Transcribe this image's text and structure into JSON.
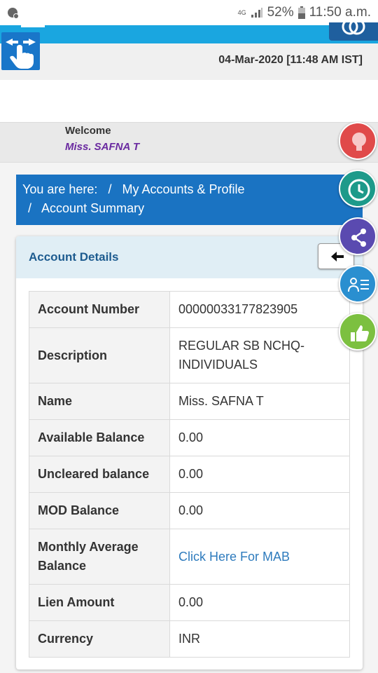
{
  "status_bar": {
    "network": "4G",
    "battery": "52%",
    "time": "11:50 a.m."
  },
  "header": {
    "datetime": "04-Mar-2020 [11:48 AM IST]"
  },
  "welcome": {
    "label": "Welcome",
    "name": "Miss. SAFNA T"
  },
  "breadcrumb": {
    "prefix": "You are here:",
    "separator": "/",
    "items": [
      "My Accounts & Profile",
      "Account Summary"
    ]
  },
  "panel": {
    "title": "Account Details"
  },
  "account_details": [
    {
      "label": "Account Number",
      "value": "00000033177823905"
    },
    {
      "label": "Description",
      "value": "REGULAR SB NCHQ-INDIVIDUALS"
    },
    {
      "label": "Name",
      "value": "Miss. SAFNA T"
    },
    {
      "label": "Available Balance",
      "value": "0.00"
    },
    {
      "label": "Uncleared balance",
      "value": "0.00"
    },
    {
      "label": "MOD Balance",
      "value": "0.00"
    },
    {
      "label": "Monthly Average Balance",
      "value": "Click Here For MAB"
    },
    {
      "label": "Lien Amount",
      "value": "0.00"
    },
    {
      "label": "Currency",
      "value": "INR"
    }
  ],
  "icons": {
    "status_left": "notification-icon",
    "signal": "signal-icon",
    "battery": "battery-icon",
    "logo": "swipe-hand-icon",
    "back": "arrow-left-icon",
    "fab_1": "lightbulb-icon",
    "fab_2": "history-icon",
    "fab_3": "share-icon",
    "fab_4": "list-user-icon",
    "fab_5": "thumbs-up-icon"
  },
  "colors": {
    "header_blue": "#1aa6e0",
    "breadcrumb_blue": "#1a73c2",
    "panel_title": "#1d5b8f",
    "welcome_name": "#6a2aa0",
    "link": "#2e7bbd",
    "fab_red": "#e04a4a",
    "fab_teal": "#1d9a8a",
    "fab_purple": "#5a4ab0",
    "fab_blue": "#2a8fd0",
    "fab_green": "#7cc040"
  }
}
